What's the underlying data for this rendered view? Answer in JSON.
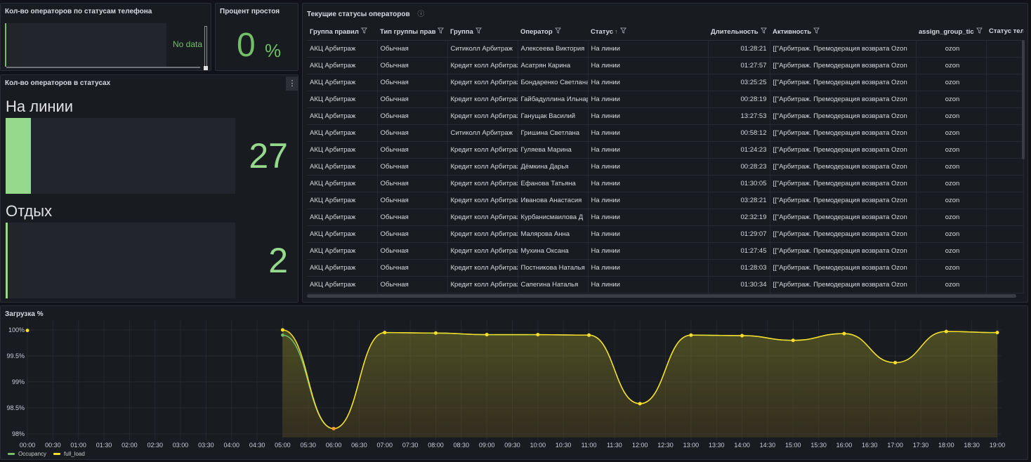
{
  "panels": {
    "phone_status": {
      "title": "Кол-во операторов по статусам телефона",
      "no_data": "No data"
    },
    "idle_percent": {
      "title": "Процент простоя",
      "value": "0",
      "unit": "%"
    },
    "status_counts": {
      "title": "Кол-во операторов в статусах",
      "menu": "⋮",
      "items": [
        {
          "label": "На линии",
          "value": "27",
          "fraction": 0.11
        },
        {
          "label": "Отдых",
          "value": "2",
          "fraction": 0.008
        }
      ]
    },
    "current_statuses": {
      "title": "Текущие статусы операторов",
      "info_icon": "ⓘ",
      "columns": [
        "Группа правил",
        "Тип группы прав",
        "Группа",
        "Оператор",
        "Статус",
        "Длительность",
        "Активность",
        "assign_group_tic",
        "Статус теле"
      ],
      "sort_indicator": "↑",
      "rows": [
        [
          "АКЦ Арбитраж",
          "Обычная",
          "Ситиколл Арбитраж",
          "Алексеева Виктория",
          "На линии",
          "01:28:21",
          "[[\"Арбитраж. Премодерация возврата Ozon",
          "ozon",
          ""
        ],
        [
          "АКЦ Арбитраж",
          "Обычная",
          "Кредит колл Арбитраж",
          "Асатрян Карина",
          "На линии",
          "01:27:57",
          "[[\"Арбитраж. Премодерация возврата Ozon",
          "ozon",
          ""
        ],
        [
          "АКЦ Арбитраж",
          "Обычная",
          "Кредит колл Арбитраж",
          "Бондаренко Светлана",
          "На линии",
          "03:25:25",
          "[[\"Арбитраж. Премодерация возврата Ozon",
          "ozon",
          ""
        ],
        [
          "АКЦ Арбитраж",
          "Обычная",
          "Кредит колл Арбитраж",
          "Гайбадуллина Ильнара",
          "На линии",
          "00:28:19",
          "[[\"Арбитраж. Премодерация возврата Ozon",
          "ozon",
          ""
        ],
        [
          "АКЦ Арбитраж",
          "Обычная",
          "Кредит колл Арбитраж",
          "Ганущак Василий",
          "На линии",
          "13:27:53",
          "[[\"Арбитраж. Премодерация возврата Ozon",
          "ozon",
          ""
        ],
        [
          "АКЦ Арбитраж",
          "Обычная",
          "Ситиколл Арбитраж",
          "Гришина Светлана",
          "На линии",
          "00:58:12",
          "[[\"Арбитраж. Премодерация возврата Ozon",
          "ozon",
          ""
        ],
        [
          "АКЦ Арбитраж",
          "Обычная",
          "Кредит колл Арбитраж",
          "Гуляева Марина",
          "На линии",
          "01:24:23",
          "[[\"Арбитраж. Премодерация возврата Ozon",
          "ozon",
          ""
        ],
        [
          "АКЦ Арбитраж",
          "Обычная",
          "Кредит колл Арбитраж",
          "Дёмкина Дарья",
          "На линии",
          "00:28:23",
          "[[\"Арбитраж. Премодерация возврата Ozon",
          "ozon",
          ""
        ],
        [
          "АКЦ Арбитраж",
          "Обычная",
          "Кредит колл Арбитраж",
          "Ефанова Татьяна",
          "На линии",
          "01:30:05",
          "[[\"Арбитраж. Премодерация возврата Ozon",
          "ozon",
          ""
        ],
        [
          "АКЦ Арбитраж",
          "Обычная",
          "Кредит колл Арбитраж",
          "Иванова Анастасия",
          "На линии",
          "03:28:21",
          "[[\"Арбитраж. Премодерация возврата Ozon",
          "ozon",
          ""
        ],
        [
          "АКЦ Арбитраж",
          "Обычная",
          "Кредит колл Арбитраж",
          "Курбанисмаилова Д",
          "На линии",
          "02:32:19",
          "[[\"Арбитраж. Премодерация возврата Ozon",
          "ozon",
          ""
        ],
        [
          "АКЦ Арбитраж",
          "Обычная",
          "Кредит колл Арбитраж",
          "Малярова Анна",
          "На линии",
          "01:29:07",
          "[[\"Арбитраж. Премодерация возврата Ozon",
          "ozon",
          ""
        ],
        [
          "АКЦ Арбитраж",
          "Обычная",
          "Кредит колл Арбитраж",
          "Мухина Оксана",
          "На линии",
          "01:27:45",
          "[[\"Арбитраж. Премодерация возврата Ozon",
          "ozon",
          ""
        ],
        [
          "АКЦ Арбитраж",
          "Обычная",
          "Кредит колл Арбитраж",
          "Постникова Наталья",
          "На линии",
          "01:28:03",
          "[[\"Арбитраж. Премодерация возврата Ozon",
          "ozon",
          ""
        ],
        [
          "АКЦ Арбитраж",
          "Обычная",
          "Кредит колл Арбитраж",
          "Сапегина Наталья",
          "На линии",
          "01:30:34",
          "[[\"Арбитраж. Премодерация возврата Ozon",
          "ozon",
          ""
        ]
      ]
    },
    "load": {
      "title": "Загрузка %"
    }
  },
  "colors": {
    "green": "#73bf69",
    "yellow": "#fade2a",
    "orange": "#ff9830"
  },
  "chart_data": {
    "type": "line",
    "title": "Загрузка %",
    "xlabel": "",
    "ylabel": "",
    "y_ticks": [
      "98%",
      "98.5%",
      "99%",
      "99.5%",
      "100%"
    ],
    "y_tick_values": [
      98,
      98.5,
      99,
      99.5,
      100
    ],
    "ylim": [
      97.93,
      100.08
    ],
    "x_ticks": [
      "00:00",
      "00:30",
      "01:00",
      "01:30",
      "02:00",
      "02:30",
      "03:00",
      "03:30",
      "04:00",
      "04:30",
      "05:00",
      "05:30",
      "06:00",
      "06:30",
      "07:00",
      "07:30",
      "08:00",
      "08:30",
      "09:00",
      "09:30",
      "10:00",
      "10:30",
      "11:00",
      "11:30",
      "12:00",
      "12:30",
      "13:00",
      "13:30",
      "14:00",
      "14:30",
      "15:00",
      "15:30",
      "16:00",
      "16:30",
      "17:00",
      "17:30",
      "18:00",
      "18:30",
      "19:00"
    ],
    "grid": true,
    "legend": "bottom-left",
    "series": [
      {
        "name": "Occupancy",
        "color": "#73bf69",
        "x": [
          "05:00",
          "06:00",
          "07:00",
          "08:00",
          "09:00",
          "10:00",
          "11:00",
          "12:00",
          "13:00",
          "14:00",
          "15:00",
          "16:00",
          "17:00",
          "18:00",
          "19:00"
        ],
        "y": [
          99.9,
          98.1,
          99.95,
          99.94,
          99.91,
          99.91,
          99.9,
          98.58,
          99.9,
          99.89,
          99.8,
          99.93,
          99.37,
          99.97,
          99.95
        ]
      },
      {
        "name": "full_load",
        "color": "#fade2a",
        "x": [
          "00:00",
          "05:00",
          "06:00",
          "07:00",
          "08:00",
          "09:00",
          "10:00",
          "11:00",
          "12:00",
          "13:00",
          "14:00",
          "15:00",
          "16:00",
          "17:00",
          "18:00",
          "19:00"
        ],
        "y": [
          99.99,
          100.0,
          98.1,
          99.95,
          99.94,
          99.91,
          99.91,
          99.9,
          98.58,
          99.9,
          99.89,
          99.8,
          99.93,
          99.37,
          99.97,
          99.95
        ]
      }
    ]
  }
}
